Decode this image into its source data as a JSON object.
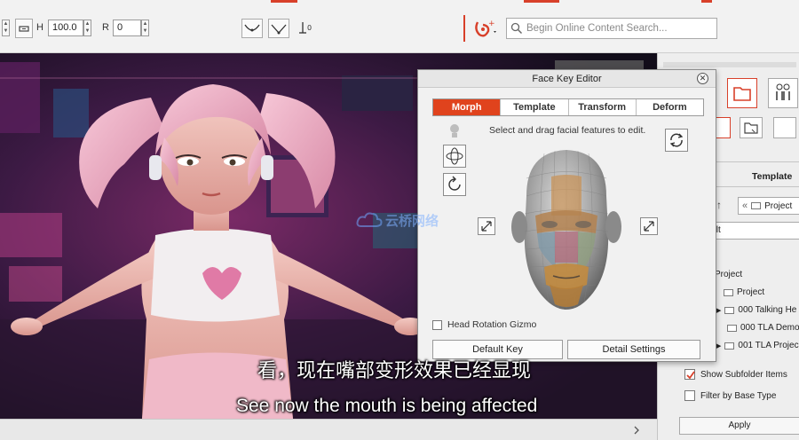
{
  "toolbar": {
    "h_label": "H",
    "h_value": "100.0",
    "r_label": "R",
    "r_value": "0",
    "search_placeholder": "Begin Online Content Search..."
  },
  "dialog": {
    "title": "Face Key Editor",
    "tabs": [
      "Morph",
      "Template",
      "Transform",
      "Deform"
    ],
    "active_tab": "Morph",
    "hint": "Select and drag facial features to edit.",
    "head_rotation_label": "Head Rotation Gizmo",
    "default_key_label": "Default Key",
    "detail_settings_label": "Detail Settings"
  },
  "watermark": "云桥网络",
  "subtitles": {
    "chinese": "看，现在嘴部变形效果已经显现",
    "english": "See now the mouth is being affected"
  },
  "right_panel": {
    "template_label": "Template",
    "project_nav": "Project",
    "partial_text": "ılt",
    "tree": [
      {
        "label": "Project",
        "indent": 0
      },
      {
        "label": "Project",
        "indent": 1
      },
      {
        "label": "000 Talking He",
        "indent": 2
      },
      {
        "label": "000 TLA Demo",
        "indent": 2
      },
      {
        "label": "001 TLA Projec",
        "indent": 2
      }
    ],
    "show_subfolder_label": "Show Subfolder Items",
    "filter_base_label": "Filter by Base Type",
    "apply_label": "Apply"
  },
  "colors": {
    "accent": "#e0431d",
    "brand_red": "#d8402a"
  }
}
